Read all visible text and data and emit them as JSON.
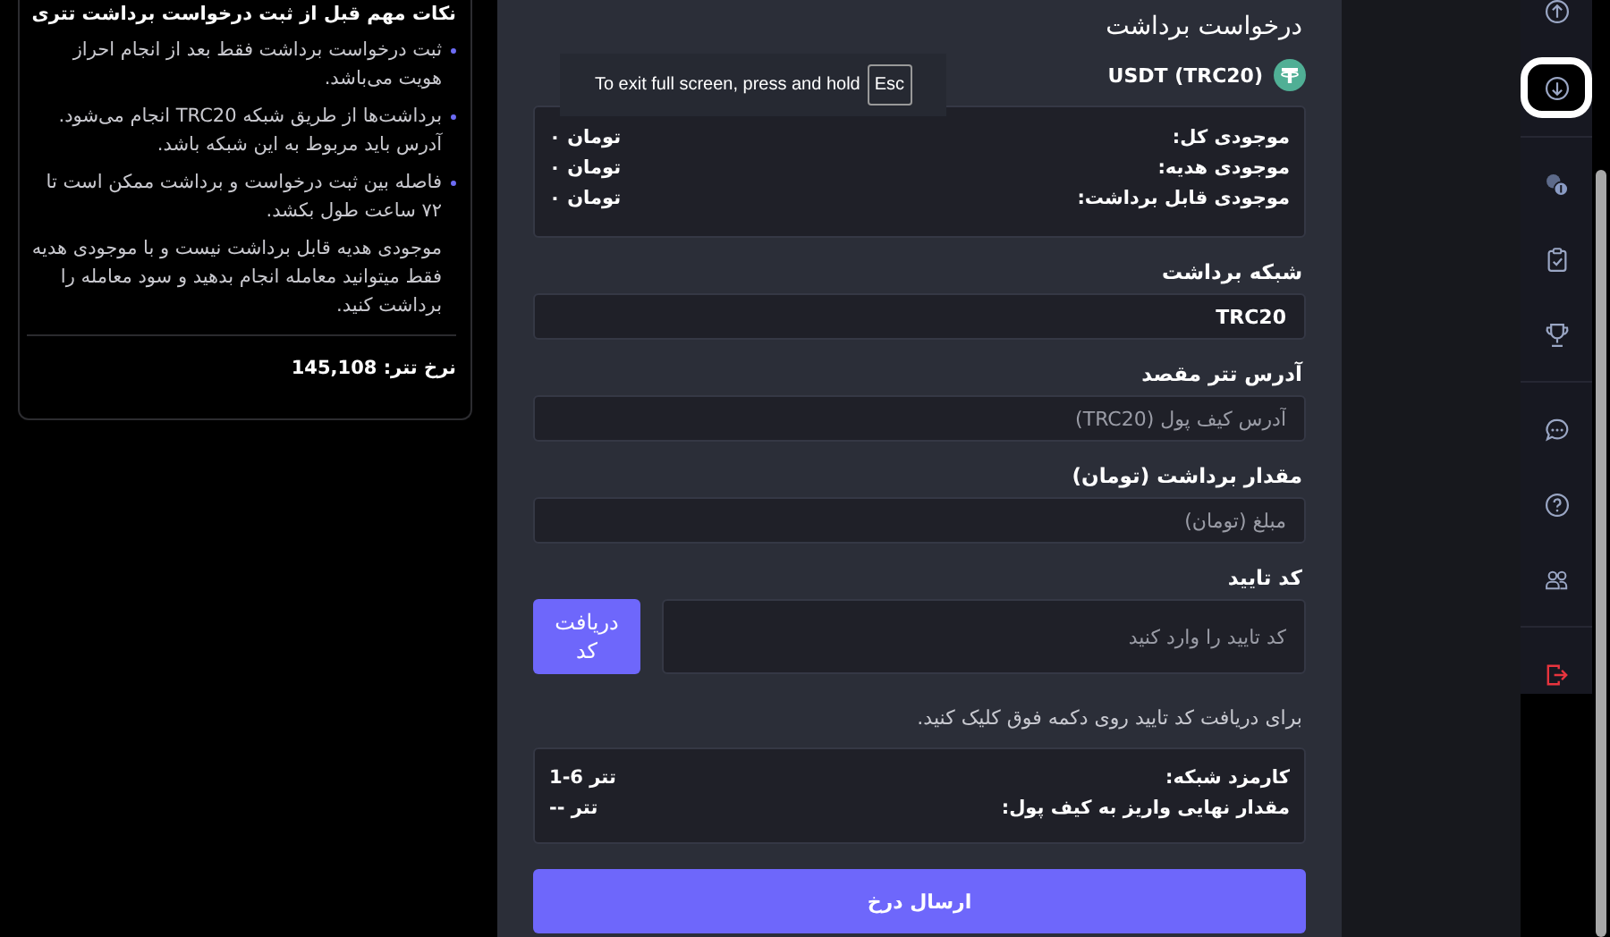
{
  "notice_panel": {
    "title": "نکات مهم قبل از ثبت درخواست برداشت تتری",
    "bullets": [
      "ثبت درخواست برداشت فقط بعد از انجام احراز هویت می‌باشد.",
      "برداشت‌ها از طریق شبکه TRC20 انجام می‌شود. آدرس باید مربوط به این شبکه باشد.",
      "فاصله بین ثبت درخواست و برداشت ممکن است تا ۷۲ ساعت طول بکشد."
    ],
    "note": "موجودی هدیه قابل برداشت نیست و با موجودی هدیه فقط میتوانید معامله انجام بدهید و سود معامله را برداشت کنید.",
    "rate": "نرخ تتر: 145,108"
  },
  "fullscreen_toast": {
    "text": "To exit full screen, press and hold",
    "key": "Esc"
  },
  "withdraw_form": {
    "title": "درخواست برداشت",
    "asset": "USDT (TRC20)",
    "balances": [
      {
        "label": "موجودی کل:",
        "value": "تومان ۰"
      },
      {
        "label": "موجودی هدیه:",
        "value": "تومان ۰"
      },
      {
        "label": "موجودی قابل برداشت:",
        "value": "تومان ۰"
      }
    ],
    "fields": [
      {
        "label": "شبکه برداشت",
        "value": "TRC20"
      },
      {
        "label": "آدرس تتر مقصد",
        "placeholder": "آدرس کیف پول (TRC20)"
      },
      {
        "label": "مقدار برداشت (تومان)",
        "placeholder": "مبلغ (تومان)"
      }
    ],
    "code": {
      "label": "کد تایید",
      "placeholder": "کد تایید را وارد کنید",
      "button": "دریافت کد",
      "hint": "برای دریافت کد تایید روی دکمه فوق کلیک کنید."
    },
    "fees": [
      {
        "label": "کارمزد شبکه:",
        "value": "تتر 6-1"
      },
      {
        "label": "مقدار نهایی واریز به کیف پول:",
        "value": "تتر --"
      }
    ],
    "submit": "ارسال درخ"
  },
  "sidebar": {
    "groups": [
      [
        {
          "selected": false
        },
        {
          "selected": true
        }
      ],
      [
        {
          "selected": false
        },
        {
          "selected": false
        },
        {
          "selected": false
        }
      ],
      [
        {
          "selected": false
        },
        {
          "selected": false
        },
        {
          "selected": false
        }
      ],
      [
        {
          "selected": false
        }
      ]
    ]
  }
}
